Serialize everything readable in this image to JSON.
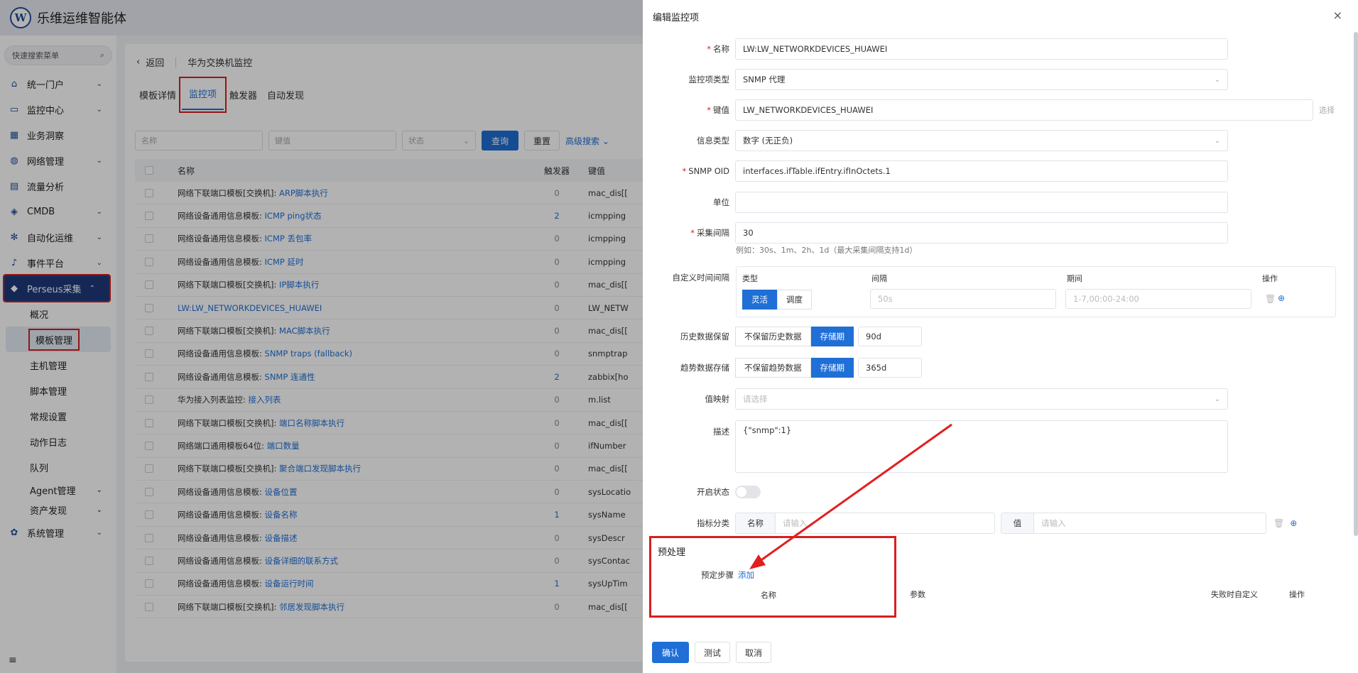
{
  "app": {
    "title": "乐维运维智能体",
    "logo_letter": "W"
  },
  "sidebar": {
    "search_placeholder": "快速搜索菜单",
    "items": [
      {
        "label": "统一门户",
        "icon": "home-icon",
        "glyph": "⌂",
        "expandable": true
      },
      {
        "label": "监控中心",
        "icon": "monitor-icon",
        "glyph": "▭",
        "expandable": true
      },
      {
        "label": "业务洞察",
        "icon": "insight-icon",
        "glyph": "▦",
        "expandable": false
      },
      {
        "label": "网络管理",
        "icon": "globe-icon",
        "glyph": "◍",
        "expandable": true
      },
      {
        "label": "流量分析",
        "icon": "chart-icon",
        "glyph": "▤",
        "expandable": false
      },
      {
        "label": "CMDB",
        "icon": "cube-icon",
        "glyph": "◈",
        "expandable": true
      },
      {
        "label": "自动化运维",
        "icon": "gear-icon",
        "glyph": "✻",
        "expandable": true
      },
      {
        "label": "事件平台",
        "icon": "bell-icon",
        "glyph": "♪",
        "expandable": true
      },
      {
        "label": "Perseus采集",
        "icon": "collect-icon",
        "glyph": "◆",
        "expandable": true,
        "active": true
      }
    ],
    "sub_items": [
      "概况",
      "模板管理",
      "主机管理",
      "脚本管理",
      "常规设置",
      "动作日志",
      "队列"
    ],
    "tail_items": [
      {
        "label": "Agent管理",
        "expandable": true
      },
      {
        "label": "资产发现",
        "expandable": true
      }
    ],
    "system_item": {
      "label": "系统管理",
      "icon": "settings-icon",
      "glyph": "✿"
    },
    "collapse_icon": "≡"
  },
  "main": {
    "back_label": "返回",
    "page_title": "华为交换机监控",
    "tabs": [
      "模板详情",
      "监控项",
      "触发器",
      "自动发现"
    ],
    "filters": {
      "name_ph": "名称",
      "key_ph": "键值",
      "status_ph": "状态",
      "search_btn": "查询",
      "reset_btn": "重置",
      "advanced": "高级搜索"
    },
    "columns": {
      "name": "名称",
      "trigger": "触发器",
      "key": "键值"
    },
    "rows": [
      {
        "prefix": "网络下联端口模板[交换机]: ",
        "name": "ARP脚本执行",
        "trig": "0",
        "key": "mac_dis[["
      },
      {
        "prefix": "网络设备通用信息模板: ",
        "name": "ICMP ping状态",
        "trig": "2",
        "key": "icmpping"
      },
      {
        "prefix": "网络设备通用信息模板: ",
        "name": "ICMP 丢包率",
        "trig": "0",
        "key": "icmpping"
      },
      {
        "prefix": "网络设备通用信息模板: ",
        "name": "ICMP 延时",
        "trig": "0",
        "key": "icmpping"
      },
      {
        "prefix": "网络下联端口模板[交换机]: ",
        "name": "IP脚本执行",
        "trig": "0",
        "key": "mac_dis[["
      },
      {
        "prefix": "",
        "name": "LW:LW_NETWORKDEVICES_HUAWEI",
        "trig": "0",
        "key": "LW_NETW"
      },
      {
        "prefix": "网络下联端口模板[交换机]: ",
        "name": "MAC脚本执行",
        "trig": "0",
        "key": "mac_dis[["
      },
      {
        "prefix": "网络设备通用信息模板: ",
        "name": "SNMP traps (fallback)",
        "trig": "0",
        "key": "snmptrap"
      },
      {
        "prefix": "网络设备通用信息模板: ",
        "name": "SNMP 连通性",
        "trig": "2",
        "key": "zabbix[ho"
      },
      {
        "prefix": "华为接入列表监控: ",
        "name": "接入列表",
        "trig": "0",
        "key": "m.list"
      },
      {
        "prefix": "网络下联端口模板[交换机]: ",
        "name": "端口名称脚本执行",
        "trig": "0",
        "key": "mac_dis[["
      },
      {
        "prefix": "网络端口通用模板64位: ",
        "name": "端口数量",
        "trig": "0",
        "key": "ifNumber"
      },
      {
        "prefix": "网络下联端口模板[交换机]: ",
        "name": "聚合端口发现脚本执行",
        "trig": "0",
        "key": "mac_dis[["
      },
      {
        "prefix": "网络设备通用信息模板: ",
        "name": "设备位置",
        "trig": "0",
        "key": "sysLocatio"
      },
      {
        "prefix": "网络设备通用信息模板: ",
        "name": "设备名称",
        "trig": "1",
        "key": "sysName"
      },
      {
        "prefix": "网络设备通用信息模板: ",
        "name": "设备描述",
        "trig": "0",
        "key": "sysDescr"
      },
      {
        "prefix": "网络设备通用信息模板: ",
        "name": "设备详细的联系方式",
        "trig": "0",
        "key": "sysContac"
      },
      {
        "prefix": "网络设备通用信息模板: ",
        "name": "设备运行时间",
        "trig": "1",
        "key": "sysUpTim"
      },
      {
        "prefix": "网络下联端口模板[交换机]: ",
        "name": "邻居发现脚本执行",
        "trig": "0",
        "key": "mac_dis[["
      }
    ]
  },
  "drawer": {
    "title": "编辑监控项",
    "close": "×",
    "labels": {
      "name": "名称",
      "type": "监控项类型",
      "key": "键值",
      "info_type": "信息类型",
      "oid": "SNMP OID",
      "unit": "单位",
      "interval": "采集间隔",
      "custom_interval": "自定义时间间隔",
      "history": "历史数据保留",
      "trend": "趋势数据存储",
      "value_map": "值映射",
      "desc": "描述",
      "status": "开启状态",
      "tag": "指标分类"
    },
    "values": {
      "name": "LW:LW_NETWORKDEVICES_HUAWEI",
      "type": "SNMP 代理",
      "key": "LW_NETWORKDEVICES_HUAWEI",
      "key_select": "选择",
      "info_type": "数字 (无正负)",
      "oid": "interfaces.ifTable.ifEntry.ifInOctets.1",
      "unit": "",
      "interval": "30",
      "interval_hint": "例如：30s、1m、2h、1d（最大采集间隔支持1d）",
      "history_opts": [
        "不保留历史数据",
        "存储期"
      ],
      "history_value": "90d",
      "trend_opts": [
        "不保留趋势数据",
        "存储期"
      ],
      "trend_value": "365d",
      "value_map_ph": "请选择",
      "desc": "{\"snmp\":1}",
      "tag_name_label": "名称",
      "tag_name_ph": "请输入",
      "tag_value_label": "值",
      "tag_value_ph": "请输入"
    },
    "custom_interval": {
      "headers": [
        "类型",
        "间隔",
        "期间",
        "操作"
      ],
      "type_opts": [
        "灵活",
        "调度"
      ],
      "interval_ph": "50s",
      "period_ph": "1-7,00:00-24:00"
    },
    "preprocess": {
      "title": "预处理",
      "steps_label": "预定步骤",
      "add": "添加",
      "headers": [
        "名称",
        "参数",
        "失败时自定义",
        "操作"
      ]
    },
    "buttons": {
      "confirm": "确认",
      "test": "测试",
      "cancel": "取消"
    }
  },
  "colors": {
    "accent": "#1f6fd6",
    "highlight": "#d61f1f",
    "nav_active": "#1f3a7a"
  }
}
